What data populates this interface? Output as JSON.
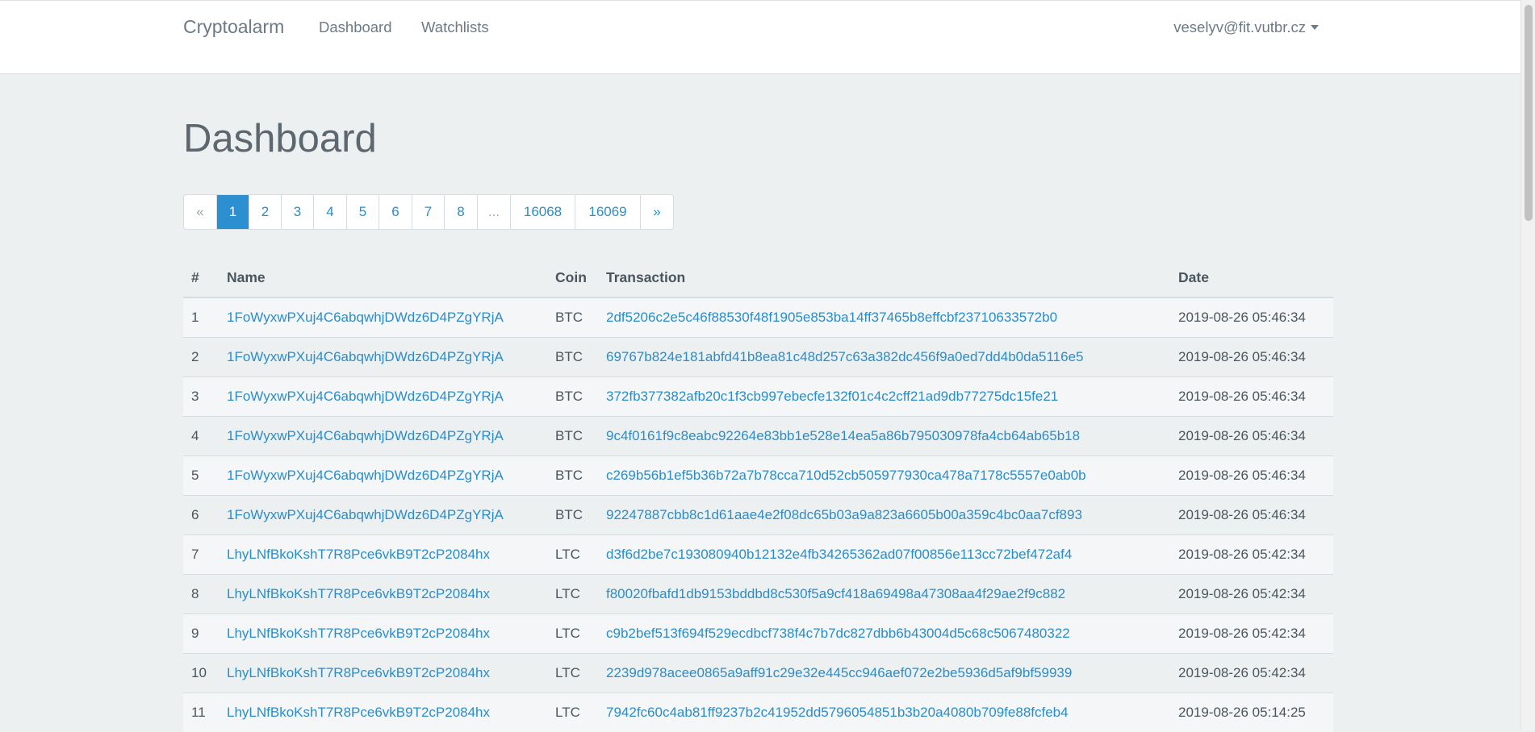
{
  "navbar": {
    "brand": "Cryptoalarm",
    "links": [
      "Dashboard",
      "Watchlists"
    ],
    "user": "veselyv@fit.vutbr.cz"
  },
  "page": {
    "title": "Dashboard"
  },
  "pagination": {
    "items": [
      "«",
      "1",
      "2",
      "3",
      "4",
      "5",
      "6",
      "7",
      "8",
      "...",
      "16068",
      "16069",
      "»"
    ],
    "active": "1"
  },
  "table": {
    "headers": [
      "#",
      "Name",
      "Coin",
      "Transaction",
      "Date"
    ],
    "rows": [
      [
        "1",
        "1FoWyxwPXuj4C6abqwhjDWdz6D4PZgYRjA",
        "BTC",
        "2df5206c2e5c46f88530f48f1905e853ba14ff37465b8effcbf23710633572b0",
        "2019-08-26 05:46:34"
      ],
      [
        "2",
        "1FoWyxwPXuj4C6abqwhjDWdz6D4PZgYRjA",
        "BTC",
        "69767b824e181abfd41b8ea81c48d257c63a382dc456f9a0ed7dd4b0da5116e5",
        "2019-08-26 05:46:34"
      ],
      [
        "3",
        "1FoWyxwPXuj4C6abqwhjDWdz6D4PZgYRjA",
        "BTC",
        "372fb377382afb20c1f3cb997ebecfe132f01c4c2cff21ad9db77275dc15fe21",
        "2019-08-26 05:46:34"
      ],
      [
        "4",
        "1FoWyxwPXuj4C6abqwhjDWdz6D4PZgYRjA",
        "BTC",
        "9c4f0161f9c8eabc92264e83bb1e528e14ea5a86b795030978fa4cb64ab65b18",
        "2019-08-26 05:46:34"
      ],
      [
        "5",
        "1FoWyxwPXuj4C6abqwhjDWdz6D4PZgYRjA",
        "BTC",
        "c269b56b1ef5b36b72a7b78cca710d52cb505977930ca478a7178c5557e0ab0b",
        "2019-08-26 05:46:34"
      ],
      [
        "6",
        "1FoWyxwPXuj4C6abqwhjDWdz6D4PZgYRjA",
        "BTC",
        "92247887cbb8c1d61aae4e2f08dc65b03a9a823a6605b00a359c4bc0aa7cf893",
        "2019-08-26 05:46:34"
      ],
      [
        "7",
        "LhyLNfBkoKshT7R8Pce6vkB9T2cP2084hx",
        "LTC",
        "d3f6d2be7c193080940b12132e4fb34265362ad07f00856e113cc72bef472af4",
        "2019-08-26 05:42:34"
      ],
      [
        "8",
        "LhyLNfBkoKshT7R8Pce6vkB9T2cP2084hx",
        "LTC",
        "f80020fbafd1db9153bddbd8c530f5a9cf418a69498a47308aa4f29ae2f9c882",
        "2019-08-26 05:42:34"
      ],
      [
        "9",
        "LhyLNfBkoKshT7R8Pce6vkB9T2cP2084hx",
        "LTC",
        "c9b2bef513f694f529ecdbcf738f4c7b7dc827dbb6b43004d5c68c5067480322",
        "2019-08-26 05:42:34"
      ],
      [
        "10",
        "LhyLNfBkoKshT7R8Pce6vkB9T2cP2084hx",
        "LTC",
        "2239d978acee0865a9aff91c29e32e445cc946aef072e2be5936d5af9bf59939",
        "2019-08-26 05:42:34"
      ],
      [
        "11",
        "LhyLNfBkoKshT7R8Pce6vkB9T2cP2084hx",
        "LTC",
        "7942fc60c4ab81ff9237b2c41952dd5796054851b3b20a4080b709fe88fcfeb4",
        "2019-08-26 05:14:25"
      ]
    ]
  }
}
